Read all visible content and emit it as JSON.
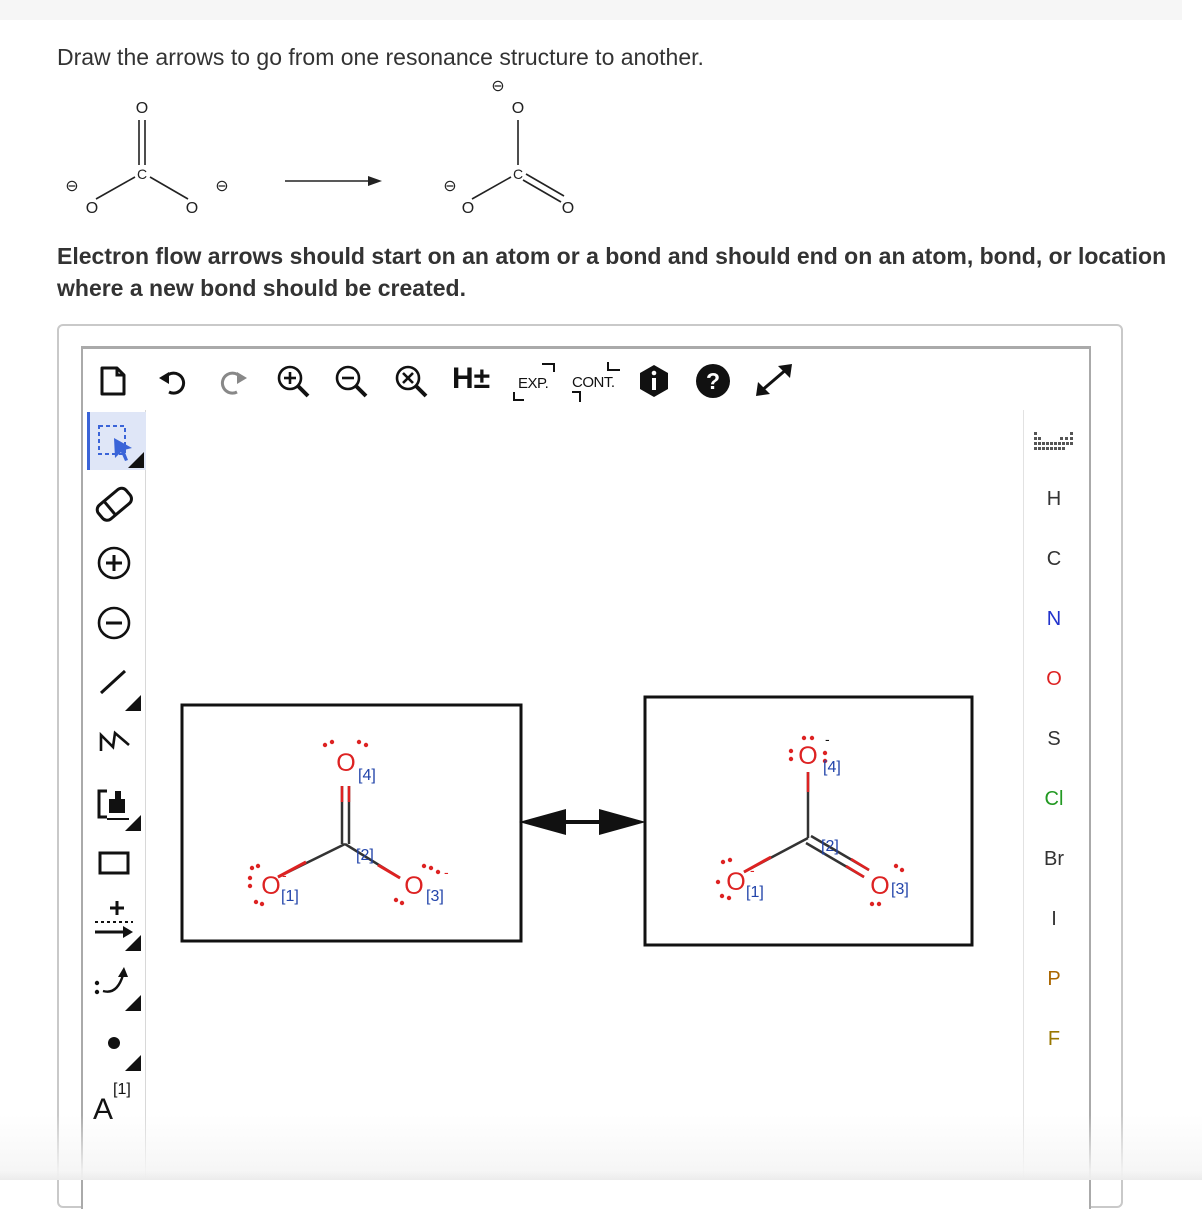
{
  "question": {
    "prompt": "Draw the arrows to go from one resonance structure to another.",
    "instruction": "Electron flow arrows should start on an atom or a bond and should end on an atom, bond, or location where a new bond should be created."
  },
  "scheme": {
    "atom_o": "O",
    "atom_c": "C",
    "charge_symbol": "⊖"
  },
  "toolbar": {
    "h_label": "H±",
    "exp_label": "EXP.",
    "cont_label": "CONT.",
    "info_label": "i",
    "help_label": "?"
  },
  "left_tools": {
    "atom_map_label": "A",
    "atom_map_index": "[1]"
  },
  "elements": [
    "H",
    "C",
    "N",
    "O",
    "S",
    "Cl",
    "Br",
    "I",
    "P",
    "F"
  ],
  "element_colors": {
    "H": "#333333",
    "C": "#333333",
    "N": "#2233cc",
    "O": "#dd2222",
    "S": "#333333",
    "Cl": "#229922",
    "Br": "#333333",
    "I": "#333333",
    "P": "#aa6600",
    "F": "#997700"
  },
  "structures": {
    "atom_label": "O",
    "left": {
      "map_labels": [
        "[1]",
        "[2]",
        "[3]",
        "[4]"
      ],
      "charge_signs": [
        "-",
        "-"
      ]
    },
    "right": {
      "map_labels": [
        "[1]",
        "[2]",
        "[3]",
        "[4]"
      ],
      "charge_signs": [
        "-",
        "-"
      ]
    }
  },
  "colors": {
    "oxygen": "#dd2222",
    "bond": "#333333",
    "map_label": "#2244aa",
    "active_tool_bg": "#dfe6f7",
    "active_tool_border": "#3a64d8"
  }
}
